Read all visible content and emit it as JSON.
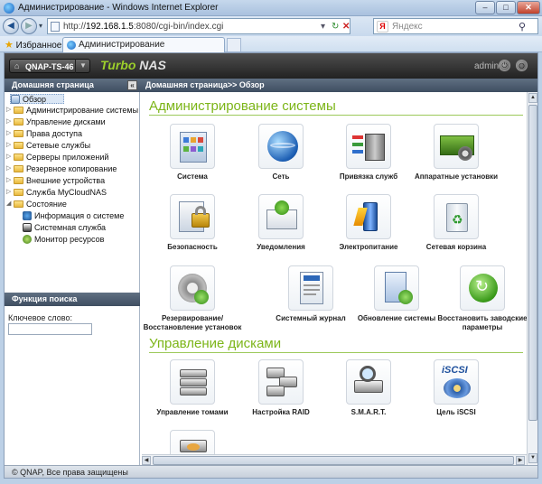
{
  "browser": {
    "window_title": "Администрирование - Windows Internet Explorer",
    "url_prefix": "http://",
    "url_host": "192.168.1.5",
    "url_rest": ":8080/cgi-bin/index.cgi",
    "search_placeholder": "Яндекс",
    "favorites_label": "Избранное",
    "tab_title": "Администрирование"
  },
  "header": {
    "device_name": "QNAP-TS-46",
    "brand_turbo": "Turbo",
    "brand_nas": "NAS",
    "user": "admin"
  },
  "sidebar": {
    "title": "Домашняя страница",
    "items": [
      {
        "label": "Обзор"
      },
      {
        "label": "Администрирование системы"
      },
      {
        "label": "Управление дисками"
      },
      {
        "label": "Права доступа"
      },
      {
        "label": "Сетевые службы"
      },
      {
        "label": "Серверы приложений"
      },
      {
        "label": "Резервное копирование"
      },
      {
        "label": "Внешние устройства"
      },
      {
        "label": "Служба MyCloudNAS"
      },
      {
        "label": "Состояние"
      },
      {
        "label": "Информация о системе"
      },
      {
        "label": "Системная служба"
      },
      {
        "label": "Монитор ресурсов"
      }
    ]
  },
  "search_panel": {
    "title": "Функция поиска",
    "keyword_label": "Ключевое слово:"
  },
  "breadcrumb": "Домашняя страница>> Обзор",
  "sections": {
    "admin": {
      "title": "Администрирование системы",
      "tiles": [
        {
          "label": "Система",
          "icon": "system-settings-icon"
        },
        {
          "label": "Сеть",
          "icon": "network-globe-icon"
        },
        {
          "label": "Привязка служб",
          "icon": "service-binding-icon"
        },
        {
          "label": "Аппаратные установки",
          "icon": "hardware-settings-icon"
        },
        {
          "label": "Безопасность",
          "icon": "security-lock-icon"
        },
        {
          "label": "Уведомления",
          "icon": "notification-mail-icon"
        },
        {
          "label": "Электропитание",
          "icon": "power-battery-icon"
        },
        {
          "label": "Сетевая корзина",
          "icon": "recycle-bin-icon"
        },
        {
          "label": "Резервирование/Восстановление установок",
          "icon": "backup-restore-gear-icon"
        },
        {
          "label": "Системный журнал",
          "icon": "system-log-icon"
        },
        {
          "label": "Обновление системы",
          "icon": "firmware-update-icon"
        },
        {
          "label": "Восстановить заводские параметры",
          "icon": "factory-reset-icon"
        }
      ]
    },
    "disks": {
      "title": "Управление дисками",
      "tiles": [
        {
          "label": "Управление томами",
          "icon": "volume-management-icon"
        },
        {
          "label": "Настройка RAID",
          "icon": "raid-icon"
        },
        {
          "label": "S.M.A.R.T.",
          "icon": "smart-magnifier-icon"
        },
        {
          "label": "Цель iSCSI",
          "icon": "iscsi-target-icon"
        }
      ]
    }
  },
  "footer": "© QNAP, Все права защищены"
}
